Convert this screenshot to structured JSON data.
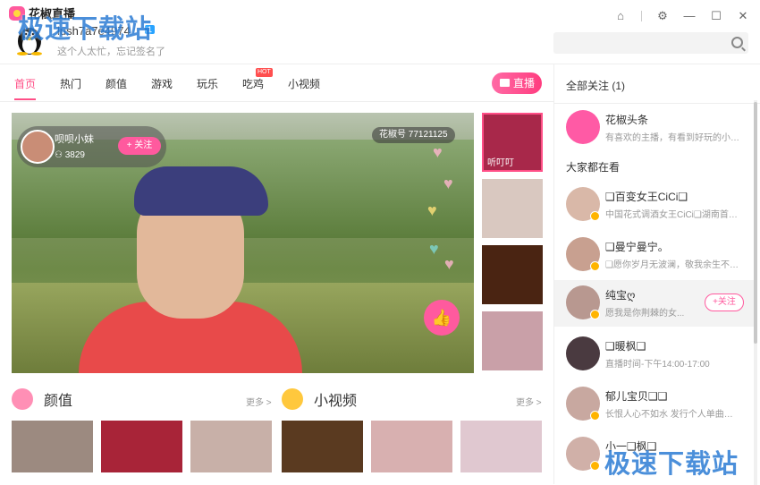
{
  "app": {
    "logo_text": "花椒直播"
  },
  "user": {
    "name": "lush7a7e4974",
    "level": "1",
    "signature": "这个人太忙，忘记签名了"
  },
  "watermark": "极速下载站",
  "window": {
    "icons": [
      "home-icon",
      "gear-icon",
      "minimize-icon",
      "maximize-icon",
      "close-icon"
    ]
  },
  "nav": {
    "tabs": [
      "首页",
      "热门",
      "颜值",
      "游戏",
      "玩乐",
      "吃鸡",
      "小视频"
    ],
    "hot_badge": "HOT",
    "live_button": "直播"
  },
  "stream": {
    "host_name": "呗呗小妹",
    "fans": "3829",
    "follow_label": "+ 关注",
    "room_label": "花椒号 77121125"
  },
  "thumbnails": [
    {
      "label": "听叮叮",
      "color": "#a8284a"
    },
    {
      "label": "",
      "color": "#d9c8c0"
    },
    {
      "label": "",
      "color": "#4a2412"
    },
    {
      "label": "",
      "color": "#c9a0a8"
    }
  ],
  "sections": [
    {
      "title": "颜值",
      "more": "更多 >",
      "icon": "face-icon",
      "color": "#ff8fb5"
    },
    {
      "title": "小视频",
      "more": "更多 >",
      "icon": "play-icon",
      "color": "#ffc83d"
    }
  ],
  "cards": [
    "#9c8a80",
    "#a82438",
    "#c8b0a8",
    "#5a3a20",
    "#d8b0b0",
    "#e0c8d0"
  ],
  "sidebar": {
    "following_label": "全部关注 (1)",
    "watching_label": "大家都在看",
    "follow_label": "+关注",
    "items": [
      {
        "name": "花椒头条",
        "desc": "有喜欢的主播，有看到好玩的小视..."
      },
      {
        "name": "❑百变女王CiCi❑",
        "desc": "中国花式调酒女王CiCi❑湖南首届..."
      },
      {
        "name": "❑曼宁曼宁。",
        "desc": "❑愿你岁月无波澜，敬我余生不悲..."
      },
      {
        "name": "纯宝ღ",
        "desc": "愿我是你荆棘的女..."
      },
      {
        "name": "❑暖枫❑",
        "desc": "直播时间-下午14:00-17:00"
      },
      {
        "name": "郁儿宝贝❑❑",
        "desc": "长恨人心不如水 发行个人单曲《..."
      },
      {
        "name": "小一❑枫❑",
        "desc": ""
      }
    ]
  }
}
